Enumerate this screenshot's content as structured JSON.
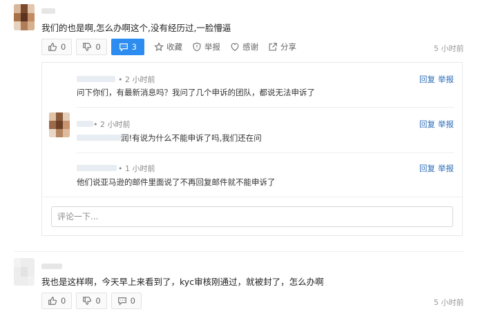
{
  "post1": {
    "text": "我们的也是啊,怎么办啊这个,没有经历过,一脸懵逼",
    "like_count": "0",
    "dislike_count": "0",
    "comment_count": "3",
    "favorite_label": "收藏",
    "report_label": "举报",
    "thanks_label": "感谢",
    "share_label": "分享",
    "time": "5 小时前"
  },
  "replies": [
    {
      "time": "• 2 小时前",
      "text": "问下你们，有最新消息吗？我问了几个申诉的团队，都说无法申诉了",
      "reply_label": "回复",
      "report_label": "举报"
    },
    {
      "time": "• 2 小时前",
      "text": "润!有说为什么不能申诉了吗,我们还在问",
      "reply_label": "回复",
      "report_label": "举报"
    },
    {
      "time": "• 1 小时前",
      "text": "他们说亚马逊的邮件里面说了不再回复邮件就不能申诉了",
      "reply_label": "回复",
      "report_label": "举报"
    }
  ],
  "comment_input": {
    "placeholder": "评论一下..."
  },
  "post2": {
    "text": "我也是这样啊，今天早上来看到了，kyc审核刚通过，就被封了，怎么办啊",
    "like_count": "0",
    "dislike_count": "0",
    "comment_count": "0",
    "time": "5 小时前"
  }
}
